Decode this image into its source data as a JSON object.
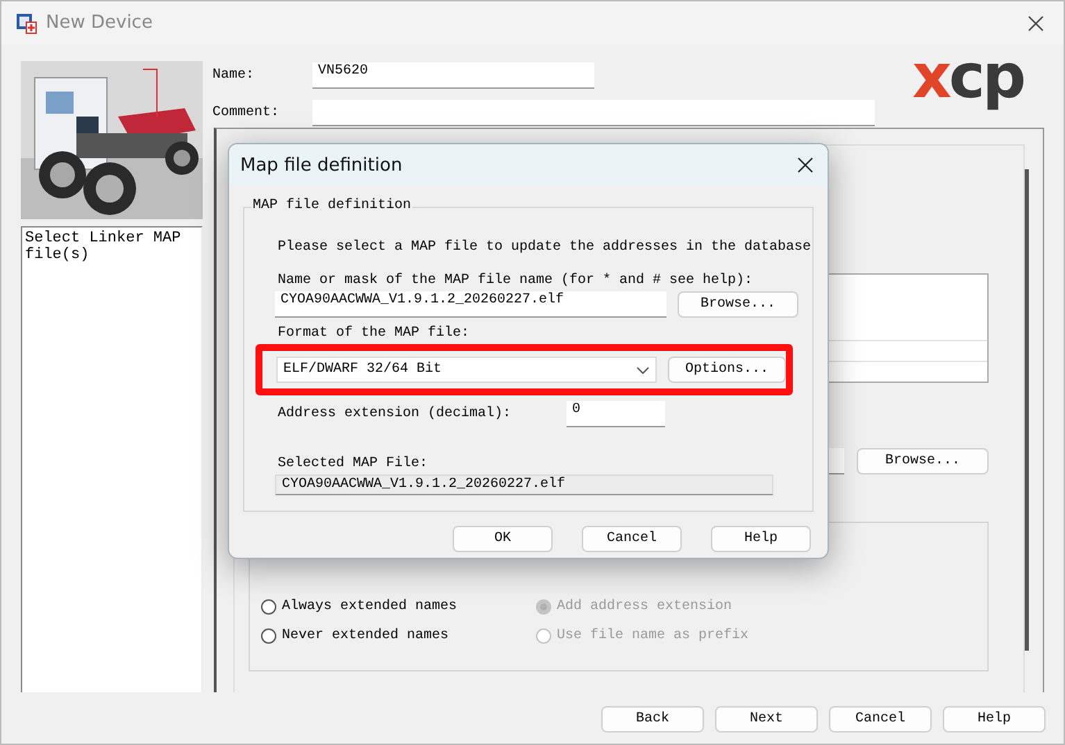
{
  "window": {
    "title": "New Device"
  },
  "sidebar": {
    "description": "Select Linker MAP file(s)"
  },
  "fields": [
    {
      "label": "Name:",
      "value": "VN5620"
    },
    {
      "label": "Comment:"
    }
  ],
  "logo": "xcp",
  "settings": {
    "browse_button": "Browse...",
    "options": [
      {
        "label": "Always extended names",
        "selected": false,
        "disabled": false
      },
      {
        "label": "Add address extension",
        "selected": true,
        "disabled": true
      },
      {
        "label": "Never extended names",
        "selected": false,
        "disabled": false
      },
      {
        "label": "Use file name as prefix",
        "selected": false,
        "disabled": true
      }
    ]
  },
  "buttons": [
    "Back",
    "Next",
    "Cancel",
    "Help"
  ],
  "dialog": {
    "title": "Map file definition",
    "group": "MAP file definition",
    "instruction": "Please select a MAP file to update the addresses in the database",
    "name_label": "Name or mask of the MAP file name (for * and # see help):",
    "name_value": "CYOA90AACWWA_V1.9.1.2_20260227.elf",
    "browse_button": "Browse...",
    "format_label": "Format of the MAP file:",
    "format_value": "ELF/DWARF 32/64 Bit",
    "format_highlighted": true,
    "options_button": "Options...",
    "address_label": "Address extension (decimal):",
    "address_value": "0",
    "selected_label": "Selected MAP File:",
    "selected_value": "CYOA90AACWWA_V1.9.1.2_20260227.elf",
    "buttons": [
      "OK",
      "Cancel",
      "Help"
    ]
  }
}
